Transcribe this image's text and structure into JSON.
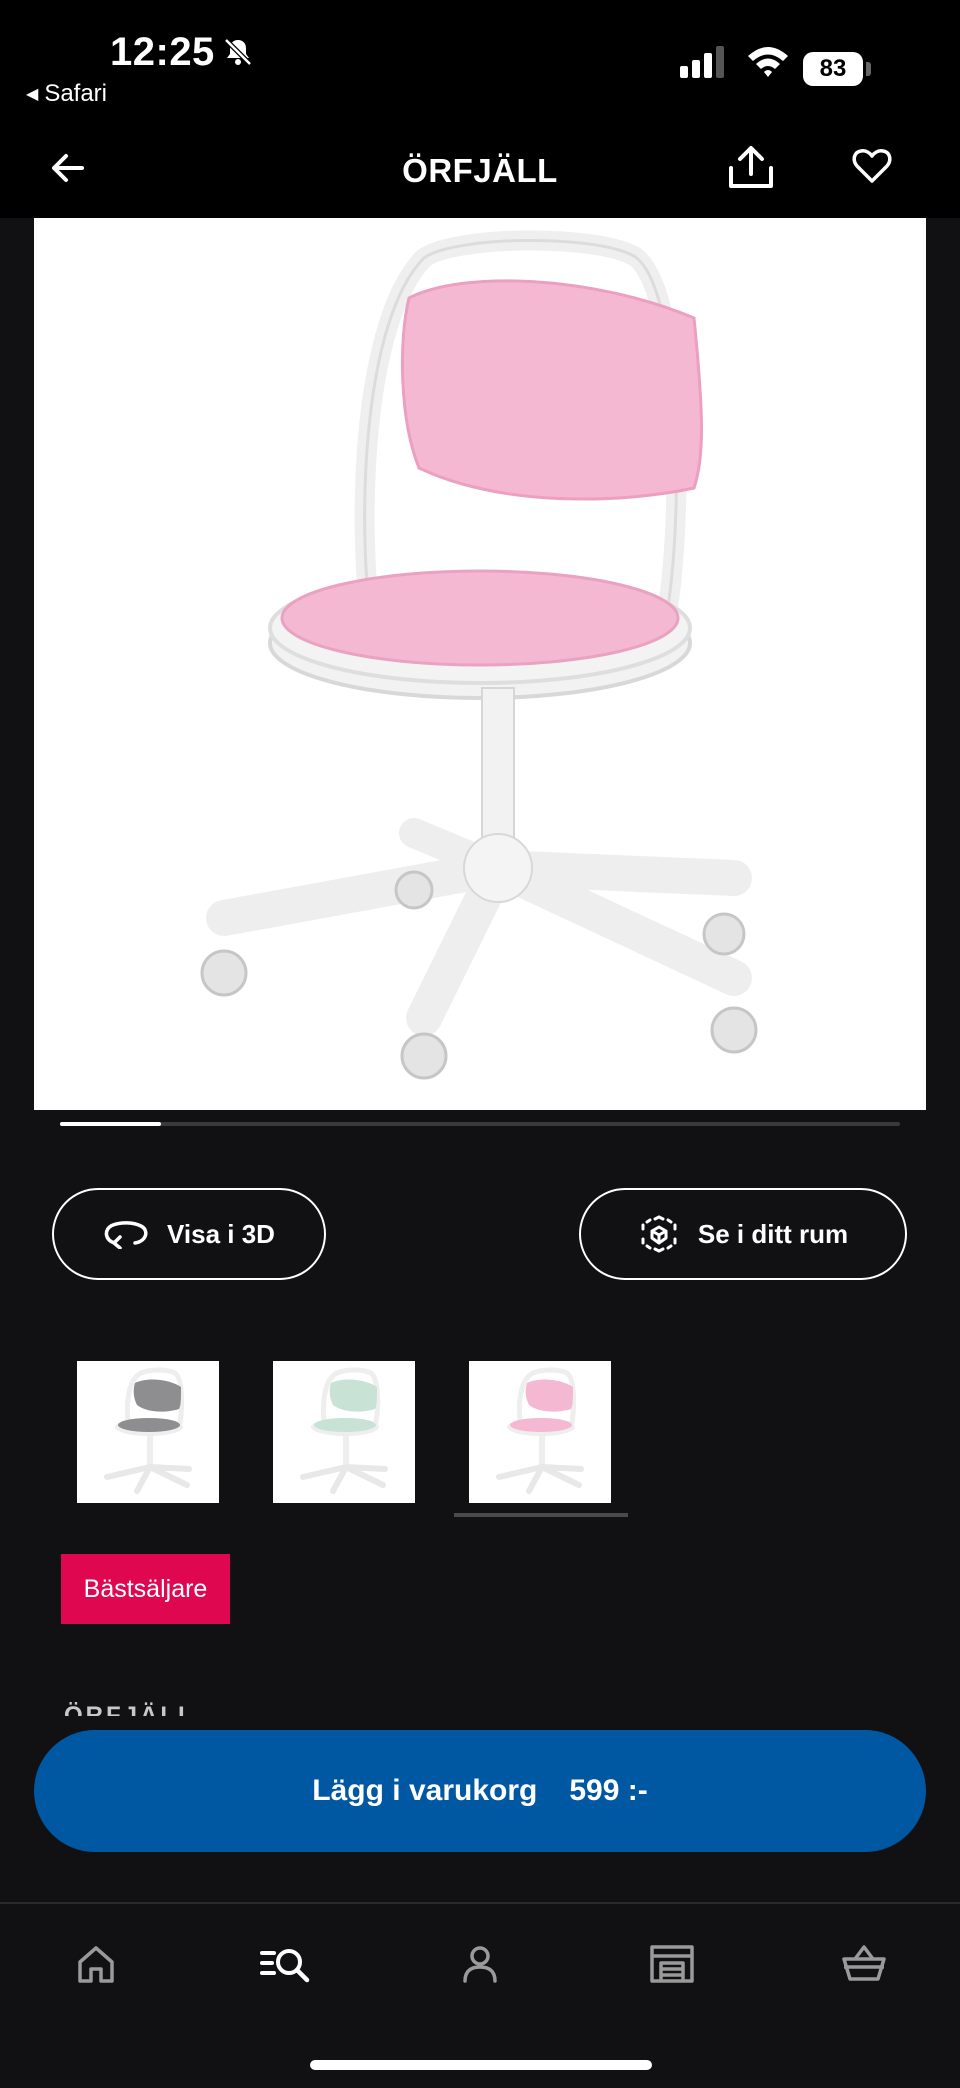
{
  "status_bar": {
    "time": "12:25",
    "back_app": "Safari",
    "battery": "83",
    "icons": [
      "bell-slash-icon",
      "signal-icon",
      "wifi-icon",
      "battery-icon"
    ]
  },
  "header": {
    "title": "ÖRFJÄLL",
    "icons": [
      "back-arrow-icon",
      "share-icon",
      "heart-icon"
    ]
  },
  "gallery": {
    "progress": 0.12,
    "thumbnails": [
      {
        "name": "grey",
        "seat_color": "#8e8e90"
      },
      {
        "name": "green",
        "seat_color": "#c9e2d6"
      },
      {
        "name": "pink",
        "seat_color": "#f5b8d2"
      }
    ],
    "selected_thumbnail": 2
  },
  "actions": {
    "view_3d_label": "Visa i 3D",
    "view_room_label": "Se i ditt rum"
  },
  "badge": "Bästsäljare",
  "section_peek": "ÖRFJÄLL",
  "cart": {
    "label": "Lägg i varukorg",
    "price": "599 :-"
  },
  "tabbar": {
    "items": [
      "home-icon",
      "search-icon",
      "profile-icon",
      "store-icon",
      "basket-icon"
    ]
  },
  "colors": {
    "background": "#111113",
    "cta_blue": "#0058a3",
    "badge_red": "#e00751",
    "seat_pink": "#f5b8d2"
  }
}
